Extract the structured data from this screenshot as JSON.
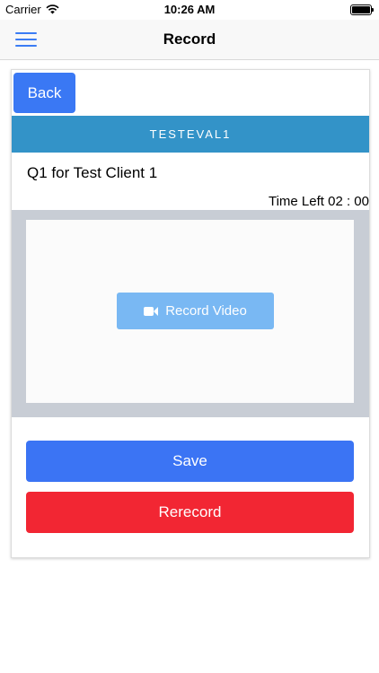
{
  "status_bar": {
    "carrier": "Carrier",
    "time": "10:26 AM",
    "wifi_icon": "wifi-icon",
    "battery_icon": "battery-icon"
  },
  "nav": {
    "title": "Record",
    "menu_icon": "hamburger-menu-icon",
    "accent_color": "#3b7cf4"
  },
  "card": {
    "back_label": "Back",
    "section_title": "TESTEVAL1",
    "question": "Q1 for Test Client 1",
    "time_left": "Time Left 02 : 00",
    "record_label": "Record Video",
    "record_icon": "video-camera-icon",
    "save_label": "Save",
    "rerecord_label": "Rerecord"
  },
  "colors": {
    "primary": "#3a78f4",
    "header": "#3393c8",
    "record_button": "#79b8f3",
    "danger": "#f22633",
    "video_frame": "#c8cdd5"
  }
}
